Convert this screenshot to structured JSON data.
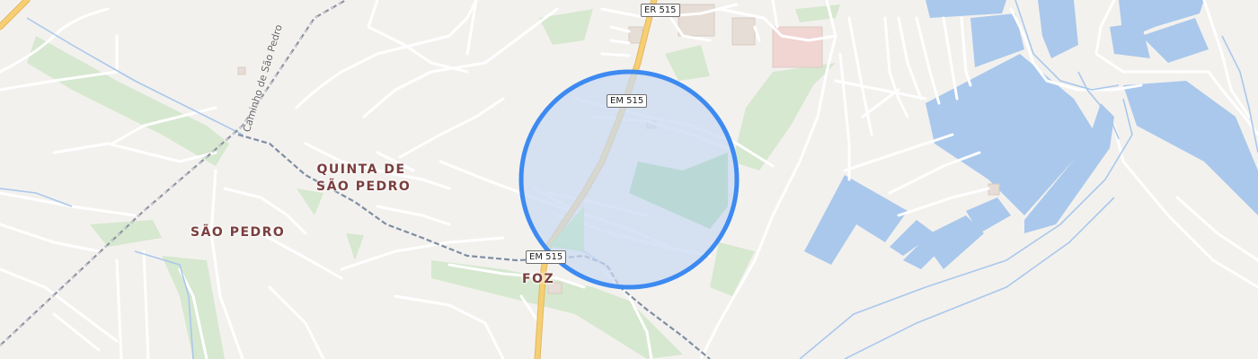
{
  "map": {
    "place_labels": {
      "quinta_line1": "QUINTA DE",
      "quinta_line2": "SÃO PEDRO",
      "sao_pedro": "SÃO PEDRO",
      "foz": "FOZ"
    },
    "road_shields": {
      "er515": "ER 515",
      "em515_top": "EM 515",
      "em515_bottom": "EM 515"
    },
    "street_names": {
      "caminho": "Caminho de São Pedro"
    },
    "location_marker": {
      "fill_color": "#c9daf3",
      "stroke_color": "#3d8af0"
    },
    "colors": {
      "background": "#f3f1ee",
      "water": "#a9c8ec",
      "greenery": "#d6e8cf",
      "main_road": "#f6cf72",
      "railway": "#8d93a0"
    }
  }
}
